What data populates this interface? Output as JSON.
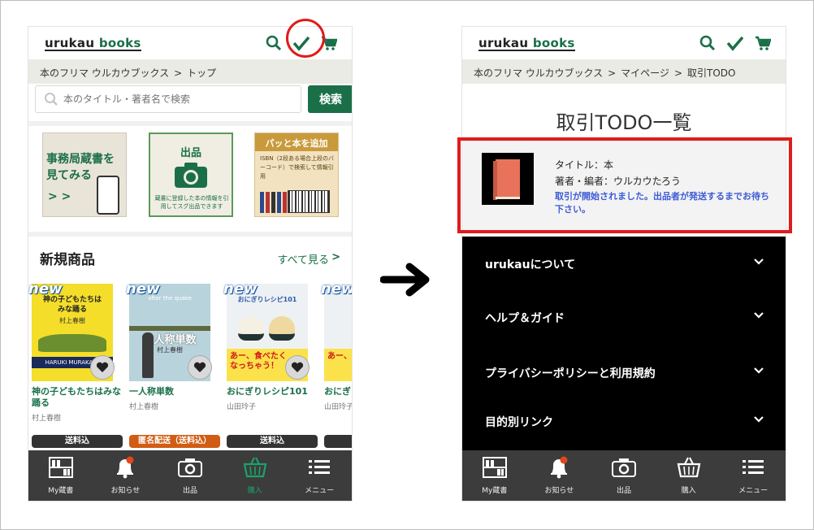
{
  "brand": {
    "logo_part1": "urukau ",
    "logo_part2": "books"
  },
  "left": {
    "breadcrumb": [
      "本のフリマ ウルカウブックス",
      "トップ"
    ],
    "search": {
      "placeholder": "本のタイトル・著者名で検索",
      "button": "検索"
    },
    "banners": {
      "b1": {
        "line1": "事務局蔵書を",
        "line2": "見てみる",
        "arrows": "> >"
      },
      "b2": {
        "title": "出品",
        "note": "蔵書に登録した本の情報を引用してスグ出品できます"
      },
      "b3": {
        "title": "パッと本を追加",
        "note": "ISBN（2段ある場合上段のバーコード）で検索して情報引用"
      }
    },
    "section": {
      "title": "新規商品",
      "see_all": "すべて見る",
      "chevron": ">"
    },
    "products": [
      {
        "new": "new",
        "title": "神の子どもたちはみな踊る",
        "author": "村上春樹",
        "badge": "送料込",
        "badge_color": "#333333",
        "cover_text": "神の子どもたちはみな踊る",
        "cover_sub": "村上春樹",
        "cover_band": "HARUKI MURAKAMI"
      },
      {
        "new": "new",
        "title": "一人称単数",
        "author": "村上春樹",
        "badge": "匿名配送（送料込）",
        "badge_color": "#d15c14",
        "cover_text": "一人称単数",
        "cover_sub": "村上春樹",
        "cover_band": "after the quake"
      },
      {
        "new": "new",
        "title": "おにぎりレシピ101",
        "author": "山田玲子",
        "badge": "送料込",
        "badge_color": "#333333",
        "cover_text": "おにぎりレシピ101",
        "cover_sub": "あー、食べたくなっちゃう！",
        "cover_band": ""
      },
      {
        "new": "new",
        "title": "おにぎ",
        "author": "山田玲子",
        "badge": "",
        "badge_color": "#333333",
        "cover_text": "",
        "cover_sub": "あー、食",
        "cover_band": ""
      }
    ],
    "nav": [
      {
        "label": "My蔵書",
        "icon": "bookshelf-icon"
      },
      {
        "label": "お知らせ",
        "icon": "bell-icon"
      },
      {
        "label": "出品",
        "icon": "camera-icon"
      },
      {
        "label": "購入",
        "icon": "basket-icon",
        "active": true
      },
      {
        "label": "メニュー",
        "icon": "menu-icon"
      }
    ]
  },
  "right": {
    "breadcrumb": [
      "本のフリマ ウルカウブックス",
      "マイページ",
      "取引TODO"
    ],
    "page_title": "取引TODO一覧",
    "todo": {
      "title_label": "タイトル：本",
      "author_label": "著者・編者：ウルカウたろう",
      "status": "取引が開始されました。出品者が発送するまでお待ち下さい。"
    },
    "footer_menu": [
      "urukauについて",
      "ヘルプ＆ガイド",
      "プライバシーポリシーと利用規約",
      "目的別リンク"
    ],
    "nav": [
      {
        "label": "My蔵書",
        "icon": "bookshelf-icon"
      },
      {
        "label": "お知らせ",
        "icon": "bell-icon"
      },
      {
        "label": "出品",
        "icon": "camera-icon"
      },
      {
        "label": "購入",
        "icon": "basket-icon"
      },
      {
        "label": "メニュー",
        "icon": "menu-icon"
      }
    ]
  },
  "colors": {
    "brand_green": "#1a6f49",
    "annotation_red": "#e01b1b",
    "status_blue": "#3d5bd6"
  }
}
